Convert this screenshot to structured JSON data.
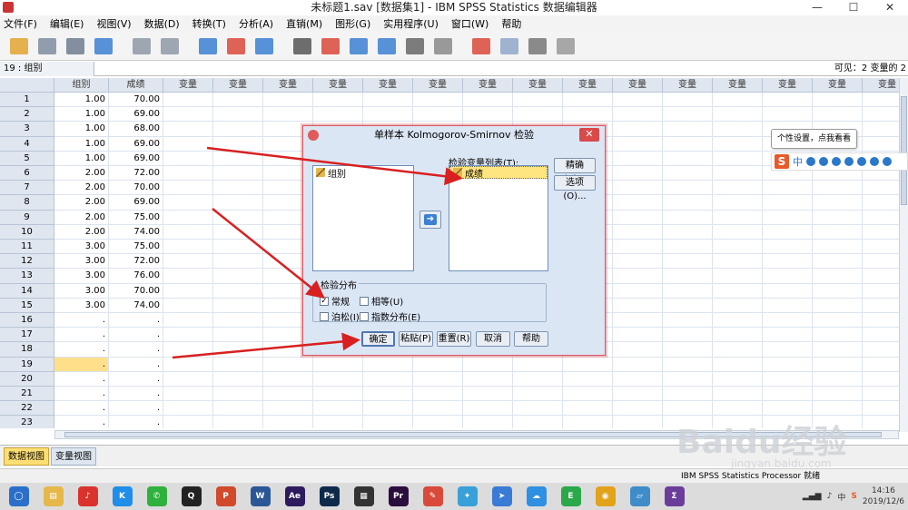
{
  "window": {
    "title": "未标题1.sav [数据集1] - IBM SPSS Statistics 数据编辑器",
    "minimize": "—",
    "maximize": "☐",
    "close": "✕"
  },
  "menu": [
    "文件(F)",
    "编辑(E)",
    "视图(V)",
    "数据(D)",
    "转换(T)",
    "分析(A)",
    "直销(M)",
    "图形(G)",
    "实用程序(U)",
    "窗口(W)",
    "帮助"
  ],
  "toolbar_icons": [
    "open-icon",
    "save-icon",
    "print-icon",
    "dialog-recall-icon",
    "undo-icon",
    "redo-icon",
    "goto-case-icon",
    "goto-variable-icon",
    "variables-icon",
    "find-icon",
    "insert-cases-icon",
    "insert-variable-icon",
    "split-file-icon",
    "weight-cases-icon",
    "select-cases-icon",
    "value-labels-icon",
    "use-sets-icon",
    "show-all-icon",
    "spell-check-icon"
  ],
  "cell_ref": "19 : 组别",
  "visible_vars": "可见：2 变量的 2",
  "grid": {
    "columns": [
      "组别",
      "成绩"
    ],
    "empty_col_label": "变量",
    "empty_col_count": 15,
    "rows": [
      [
        "1.00",
        "70.00"
      ],
      [
        "1.00",
        "69.00"
      ],
      [
        "1.00",
        "68.00"
      ],
      [
        "1.00",
        "69.00"
      ],
      [
        "1.00",
        "69.00"
      ],
      [
        "2.00",
        "72.00"
      ],
      [
        "2.00",
        "70.00"
      ],
      [
        "2.00",
        "69.00"
      ],
      [
        "2.00",
        "75.00"
      ],
      [
        "2.00",
        "74.00"
      ],
      [
        "3.00",
        "75.00"
      ],
      [
        "3.00",
        "72.00"
      ],
      [
        "3.00",
        "76.00"
      ],
      [
        "3.00",
        "70.00"
      ],
      [
        "3.00",
        "74.00"
      ],
      [
        ".",
        "."
      ],
      [
        ".",
        "."
      ],
      [
        ".",
        "."
      ],
      [
        ".",
        "."
      ],
      [
        ".",
        "."
      ],
      [
        ".",
        "."
      ],
      [
        ".",
        "."
      ],
      [
        ".",
        "."
      ]
    ],
    "selected_row": 19
  },
  "tabs": [
    "数据视图",
    "变量视图"
  ],
  "status": {
    "processor": "IBM SPSS Statistics Processor 就绪"
  },
  "dialog": {
    "title": "单样本 Kolmogorov-Smirnov 检验",
    "close": "✕",
    "source_vars": [
      "组别"
    ],
    "test_list_label": "检验变量列表(T):",
    "test_vars": [
      "成绩"
    ],
    "exact_button": "精确(X)...",
    "options_button": "选项(O)...",
    "move_arrow": "➔",
    "group_title": "检验分布",
    "checks": [
      {
        "label": "常规",
        "checked": true
      },
      {
        "label": "相等(U)",
        "checked": false
      },
      {
        "label": "泊松(I)",
        "checked": false
      },
      {
        "label": "指数分布(E)",
        "checked": false
      }
    ],
    "checkmark": "✓",
    "buttons": [
      "确定",
      "粘贴(P)",
      "重置(R)",
      "取消",
      "帮助"
    ]
  },
  "ime": {
    "tooltip": "个性设置，点我看看",
    "logo": "S",
    "mode": "中"
  },
  "taskbar_apps": [
    {
      "icon": "search-icon",
      "color": "#2a6fc9",
      "text": "◯"
    },
    {
      "icon": "file-explorer-icon",
      "color": "#e6b84a",
      "text": "▤"
    },
    {
      "icon": "netease-music-icon",
      "color": "#d9332b",
      "text": "♪"
    },
    {
      "icon": "kugou-icon",
      "color": "#1f8ee8",
      "text": "K"
    },
    {
      "icon": "wechat-icon",
      "color": "#2fb13d",
      "text": "✆"
    },
    {
      "icon": "qq-icon",
      "color": "#222222",
      "text": "Q"
    },
    {
      "icon": "powerpoint-icon",
      "color": "#d04a2b",
      "text": "P"
    },
    {
      "icon": "word-icon",
      "color": "#2b5797",
      "text": "W"
    },
    {
      "icon": "after-effects-icon",
      "color": "#2d1b5e",
      "text": "Ae"
    },
    {
      "icon": "photoshop-icon",
      "color": "#0e2a4b",
      "text": "Ps"
    },
    {
      "icon": "video-editor-icon",
      "color": "#333333",
      "text": "▦"
    },
    {
      "icon": "premiere-icon",
      "color": "#2a0f3d",
      "text": "Pr"
    },
    {
      "icon": "paint-icon",
      "color": "#d94a3a",
      "text": "✎"
    },
    {
      "icon": "bird-icon",
      "color": "#3aa0d8",
      "text": "✦"
    },
    {
      "icon": "feishu-icon",
      "color": "#3a7bd5",
      "text": "➤"
    },
    {
      "icon": "baidu-netdisk-icon",
      "color": "#2f8fe0",
      "text": "☁"
    },
    {
      "icon": "evernote-icon",
      "color": "#2aa84a",
      "text": "E"
    },
    {
      "icon": "chrome-icon",
      "color": "#e2a31b",
      "text": "◉"
    },
    {
      "icon": "notes-icon",
      "color": "#3e8dc9",
      "text": "▱"
    },
    {
      "icon": "spss-icon",
      "color": "#6a3d9a",
      "text": "Σ"
    }
  ],
  "tray": {
    "lang": "中",
    "ime": "S",
    "time": "14:16",
    "date": "2019/12/6"
  },
  "watermark": {
    "brand": "Baidu经验",
    "url": "jingyan.baidu.com"
  }
}
